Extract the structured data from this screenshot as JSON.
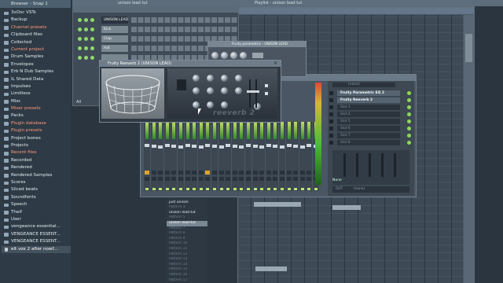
{
  "browser": {
    "title": "Browser - Snap 1",
    "items": [
      {
        "label": "3xOsc VSTs",
        "state": "normal",
        "kind": "folder"
      },
      {
        "label": "Backup",
        "state": "normal",
        "kind": "folder"
      },
      {
        "label": "Channel presets",
        "state": "hl",
        "kind": "folder"
      },
      {
        "label": "Clipboard files",
        "state": "normal",
        "kind": "folder"
      },
      {
        "label": "Collected",
        "state": "normal",
        "kind": "folder"
      },
      {
        "label": "Current project",
        "state": "hl",
        "kind": "folder"
      },
      {
        "label": "Drum Samples",
        "state": "normal",
        "kind": "folder"
      },
      {
        "label": "Envelopes",
        "state": "normal",
        "kind": "folder"
      },
      {
        "label": "Erb N Dub Samples",
        "state": "normal",
        "kind": "folder"
      },
      {
        "label": "IL Shared Data",
        "state": "normal",
        "kind": "folder"
      },
      {
        "label": "Impulses",
        "state": "normal",
        "kind": "folder"
      },
      {
        "label": "Limitless",
        "state": "normal",
        "kind": "folder"
      },
      {
        "label": "Misc",
        "state": "normal",
        "kind": "folder"
      },
      {
        "label": "Mixer presets",
        "state": "hl",
        "kind": "folder"
      },
      {
        "label": "Packs",
        "state": "normal",
        "kind": "folder"
      },
      {
        "label": "Plugin database",
        "state": "hl",
        "kind": "folder"
      },
      {
        "label": "Plugin presets",
        "state": "hl",
        "kind": "folder"
      },
      {
        "label": "Project bones",
        "state": "normal",
        "kind": "folder"
      },
      {
        "label": "Projects",
        "state": "normal",
        "kind": "folder"
      },
      {
        "label": "Recent files",
        "state": "hl",
        "kind": "folder"
      },
      {
        "label": "Recorded",
        "state": "normal",
        "kind": "folder"
      },
      {
        "label": "Rendered",
        "state": "normal",
        "kind": "folder"
      },
      {
        "label": "Rendered Samples",
        "state": "normal",
        "kind": "folder"
      },
      {
        "label": "Scores",
        "state": "normal",
        "kind": "folder"
      },
      {
        "label": "Sliced beats",
        "state": "normal",
        "kind": "folder"
      },
      {
        "label": "Soundfonts",
        "state": "normal",
        "kind": "folder"
      },
      {
        "label": "Speech",
        "state": "normal",
        "kind": "folder"
      },
      {
        "label": "Theif",
        "state": "normal",
        "kind": "folder"
      },
      {
        "label": "User",
        "state": "normal",
        "kind": "folder"
      },
      {
        "label": "vengeance essential...",
        "state": "normal",
        "kind": "folder"
      },
      {
        "label": "VENGEANCE ESSENT...",
        "state": "normal",
        "kind": "folder"
      },
      {
        "label": "VENGEANCE ESSENT...",
        "state": "normal",
        "kind": "folder"
      },
      {
        "label": "elt vox 2 after nowf...",
        "state": "sel",
        "kind": "file"
      }
    ]
  },
  "topbar": {
    "channel_title": "unison lead tut",
    "playlist_title": "Playlist - unison lead tut"
  },
  "channel_rack": {
    "channels": [
      {
        "name": "UNISON LEAD",
        "selected": true
      },
      {
        "name": "Kick",
        "selected": false
      },
      {
        "name": "Clap",
        "selected": false
      },
      {
        "name": "Hat",
        "selected": false
      },
      {
        "name": "",
        "selected": false
      }
    ],
    "filter_label": "All"
  },
  "plugin_back": {
    "title": "Fruity parametric - UNISON LEAD"
  },
  "reeverb": {
    "title": "Fruity Reeverb 2 (UNISON LEAD)",
    "logo": "reeverb 2",
    "close": "×"
  },
  "mixer": {
    "header_label": "(none)",
    "slots": [
      {
        "label": "Fruity Parametric EQ 2",
        "on": true
      },
      {
        "label": "Fruity Reeverb 2",
        "on": true
      },
      {
        "label": "Slot 3",
        "on": false
      },
      {
        "label": "Slot 4",
        "on": false
      },
      {
        "label": "Slot 5",
        "on": false
      },
      {
        "label": "Slot 6",
        "on": false
      },
      {
        "label": "Slot 7",
        "on": false
      },
      {
        "label": "Slot 8",
        "on": false
      }
    ],
    "in_none": "None",
    "out_label": "OUT",
    "out_value": "(none)",
    "strip_count": 26
  },
  "patterns": {
    "items": [
      {
        "label": "Pattern 1",
        "state": "off"
      },
      {
        "label": "just unison",
        "state": "on"
      },
      {
        "label": "Pattern 3",
        "state": "off"
      },
      {
        "label": "unison lead tut",
        "state": "on"
      },
      {
        "label": "Pattern 5",
        "state": "off"
      },
      {
        "label": "unison lead tut",
        "state": "sel"
      },
      {
        "label": "Pattern 7",
        "state": "off"
      },
      {
        "label": "Pattern 8",
        "state": "off"
      },
      {
        "label": "Pattern 9",
        "state": "off"
      },
      {
        "label": "Pattern 10",
        "state": "off"
      },
      {
        "label": "Pattern 11",
        "state": "off"
      },
      {
        "label": "Pattern 12",
        "state": "off"
      },
      {
        "label": "Pattern 13",
        "state": "off"
      },
      {
        "label": "Pattern 14",
        "state": "off"
      },
      {
        "label": "Pattern 15",
        "state": "off"
      },
      {
        "label": "Pattern 16",
        "state": "off"
      },
      {
        "label": "Pattern 17",
        "state": "off"
      }
    ]
  },
  "colors": {
    "highlight_text": "#ff9a7a",
    "meter_green": "#4bbd3a",
    "mute_amber": "#e0a32e"
  }
}
